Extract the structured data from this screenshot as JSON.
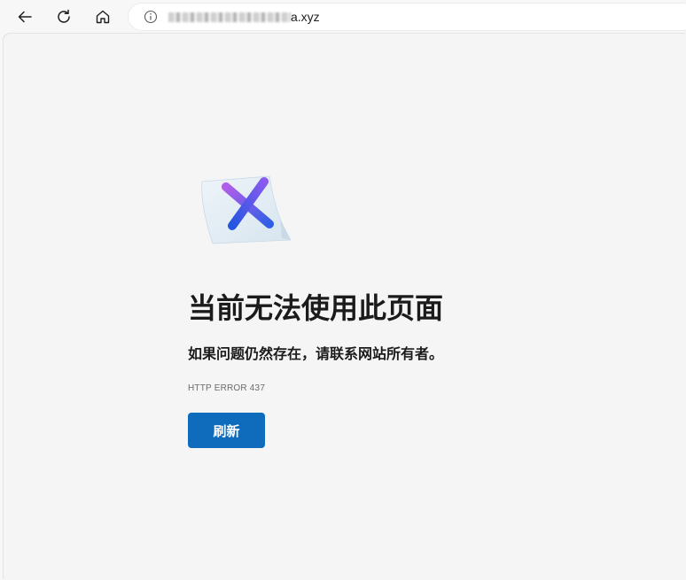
{
  "browser": {
    "back_icon": "arrow-left-icon",
    "reload_icon": "refresh-icon",
    "home_icon": "home-icon",
    "info_icon": "info-circle-icon",
    "address_visible_suffix": "a.xyz"
  },
  "error_page": {
    "illustration_icon": "error-x-document-icon",
    "title": "当前无法使用此页面",
    "subtitle": "如果问题仍然存在，请联系网站所有者。",
    "error_code": "HTTP ERROR 437",
    "refresh_label": "刷新",
    "accent_color": "#0f6cbd"
  }
}
